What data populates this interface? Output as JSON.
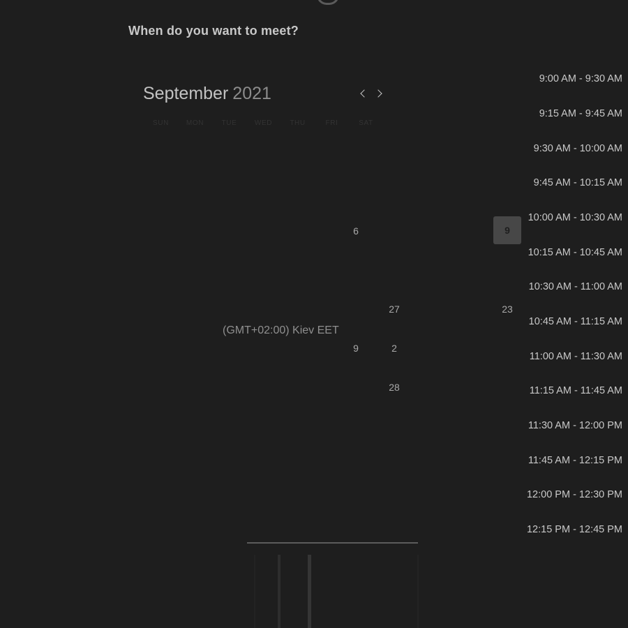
{
  "header": {
    "question": "When do you want to meet?",
    "subtitle": ""
  },
  "calendar": {
    "month": "September",
    "year": "2021",
    "weekdays": [
      "SUN",
      "MON",
      "TUE",
      "WED",
      "THU",
      "FRI",
      "SAT"
    ],
    "visible_days": [
      "6",
      "9",
      "27",
      "23",
      "9",
      "2",
      "28"
    ],
    "selected_day": "9"
  },
  "timezone": {
    "label": "(GMT+02:00) Kiev EET"
  },
  "time_slots": [
    "9:00 AM - 9:30 AM",
    "9:15 AM - 9:45 AM",
    "9:30 AM - 10:00 AM",
    "9:45 AM - 10:15 AM",
    "10:00 AM - 10:30 AM",
    "10:15 AM - 10:45 AM",
    "10:30 AM - 11:00 AM",
    "10:45 AM - 11:15 AM",
    "11:00 AM - 11:30 AM",
    "11:15 AM - 11:45 AM",
    "11:30 AM - 12:00 PM",
    "11:45 AM - 12:15 PM",
    "12:00 PM - 12:30 PM",
    "12:15 PM - 12:45 PM"
  ],
  "colors": {
    "background": "#1e1e1e",
    "selected_day_bg": "#474747",
    "text_primary": "#c9c9c9"
  }
}
